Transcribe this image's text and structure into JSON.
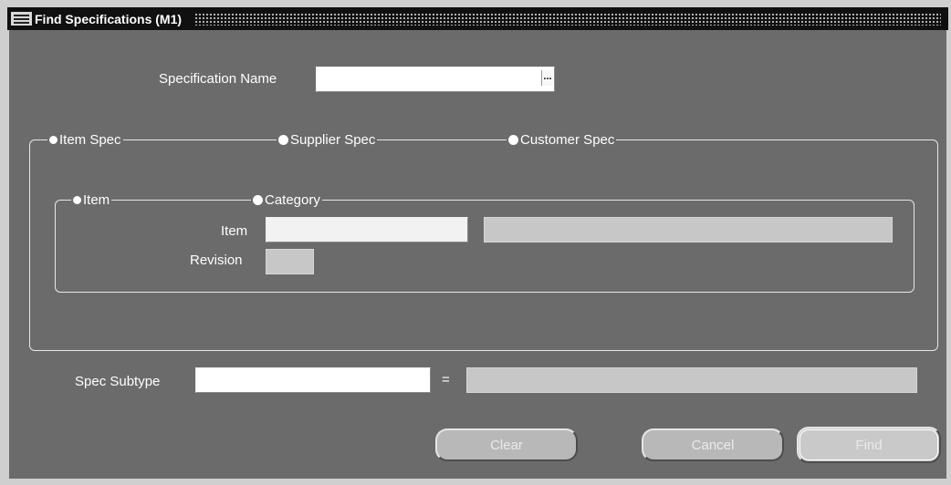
{
  "window": {
    "title": "Find Specifications (M1)"
  },
  "form": {
    "spec_name_label": "Specification Name",
    "spec_name_value": "",
    "lov_glyph": "...",
    "spec_type_options": [
      {
        "label": "Item Spec",
        "selected": true
      },
      {
        "label": "Supplier Spec",
        "selected": false
      },
      {
        "label": "Customer Spec",
        "selected": false
      }
    ],
    "item_scope_options": [
      {
        "label": "Item",
        "selected": true
      },
      {
        "label": "Category",
        "selected": false
      }
    ],
    "item_label": "Item",
    "item_value": "",
    "item_description": "",
    "revision_label": "Revision",
    "revision_value": "",
    "subtype_label": "Spec Subtype",
    "subtype_value": "",
    "subtype_operator": "=",
    "subtype_description": ""
  },
  "buttons": {
    "clear": "Clear",
    "cancel": "Cancel",
    "find": "Find"
  }
}
